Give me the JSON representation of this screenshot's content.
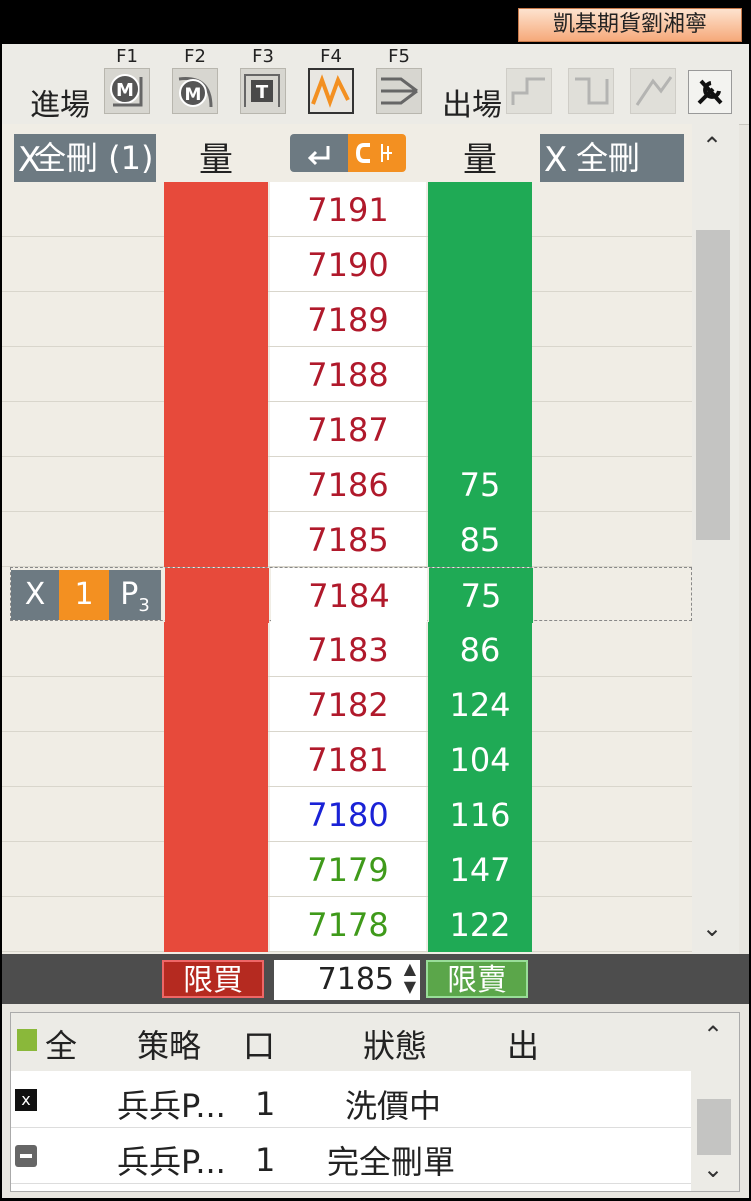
{
  "window": {
    "tab_title": "凱基期貨劉湘寧"
  },
  "toolbar": {
    "entry_label": "進場",
    "exit_label": "出場",
    "fkeys": [
      "F1",
      "F2",
      "F3",
      "F4",
      "F5"
    ],
    "buttons": [
      {
        "glyph": "M",
        "name": "market-entry-1"
      },
      {
        "glyph": "M",
        "name": "market-entry-2"
      },
      {
        "glyph": "T",
        "name": "touch-entry"
      },
      {
        "glyph": "wave",
        "name": "pingpong-entry"
      },
      {
        "glyph": "stairs",
        "name": "ladder-entry"
      }
    ],
    "tool_icon": "wrench-icon"
  },
  "ladder_header": {
    "cancel_buy_all": "全刪 (1)",
    "buy_qty": "量",
    "sell_qty": "量",
    "cancel_sell_all": "全刪",
    "x": "X"
  },
  "ladder_rows": [
    {
      "price": "7191",
      "sell_qty": "",
      "color": "#b0192b"
    },
    {
      "price": "7190",
      "sell_qty": "",
      "color": "#b0192b"
    },
    {
      "price": "7189",
      "sell_qty": "",
      "color": "#b0192b"
    },
    {
      "price": "7188",
      "sell_qty": "",
      "color": "#b0192b"
    },
    {
      "price": "7187",
      "sell_qty": "",
      "color": "#b0192b"
    },
    {
      "price": "7186",
      "sell_qty": "75",
      "color": "#b0192b"
    },
    {
      "price": "7185",
      "sell_qty": "85",
      "color": "#b0192b"
    },
    {
      "price": "7184",
      "sell_qty": "75",
      "color": "#b0192b"
    },
    {
      "price": "7183",
      "sell_qty": "86",
      "color": "#b0192b"
    },
    {
      "price": "7182",
      "sell_qty": "124",
      "color": "#b0192b"
    },
    {
      "price": "7181",
      "sell_qty": "104",
      "color": "#b0192b"
    },
    {
      "price": "7180",
      "sell_qty": "116",
      "color": "#1a22d6"
    },
    {
      "price": "7179",
      "sell_qty": "147",
      "color": "#3f9a1a"
    },
    {
      "price": "7178",
      "sell_qty": "122",
      "color": "#3f9a1a"
    }
  ],
  "working_order": {
    "x": "X",
    "qty": "1",
    "tag": "P",
    "tag_sub": "3"
  },
  "order_bar": {
    "limit_buy": "限買",
    "price": "7185",
    "limit_sell": "限賣"
  },
  "strategy_list": {
    "headers": {
      "all": "全",
      "strategy": "策略",
      "lots": "口",
      "status": "狀態",
      "exit": "出"
    },
    "rows": [
      {
        "name": "兵兵P...",
        "lots": "1",
        "status": "洗價中"
      },
      {
        "name": "兵兵P...",
        "lots": "1",
        "status": "完全刪單"
      }
    ]
  },
  "colors": {
    "buy": "#e74a3b",
    "sell": "#1faa55",
    "accent": "#f39021"
  }
}
